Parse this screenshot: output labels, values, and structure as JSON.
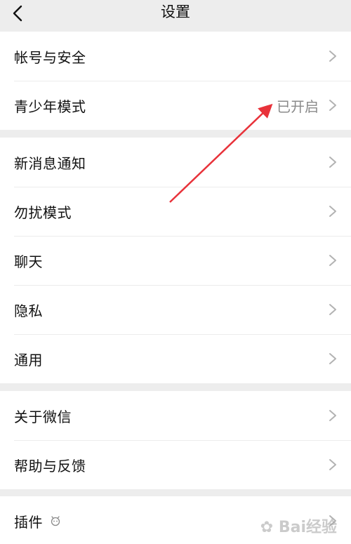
{
  "header": {
    "title": "设置",
    "back_icon": "chevron-left-icon"
  },
  "groups": [
    {
      "items": [
        {
          "label": "帐号与安全",
          "status": ""
        },
        {
          "label": "青少年模式",
          "status": "已开启"
        }
      ]
    },
    {
      "items": [
        {
          "label": "新消息通知",
          "status": ""
        },
        {
          "label": "勿扰模式",
          "status": ""
        },
        {
          "label": "聊天",
          "status": ""
        },
        {
          "label": "隐私",
          "status": ""
        },
        {
          "label": "通用",
          "status": ""
        }
      ]
    },
    {
      "items": [
        {
          "label": "关于微信",
          "status": ""
        },
        {
          "label": "帮助与反馈",
          "status": ""
        }
      ]
    },
    {
      "items": [
        {
          "label": "插件",
          "status": "",
          "icon": "plugin-icon"
        }
      ]
    }
  ],
  "annotation": {
    "type": "red-arrow",
    "color": "#e8323a",
    "target": "青少年模式 status"
  },
  "watermark": {
    "text": "Bai经验",
    "icon": "paw-icon"
  },
  "colors": {
    "background": "#ededed",
    "row_background": "#ffffff",
    "label_text": "#111111",
    "status_text": "#8a8a8a",
    "chevron": "#b2b2b2"
  }
}
